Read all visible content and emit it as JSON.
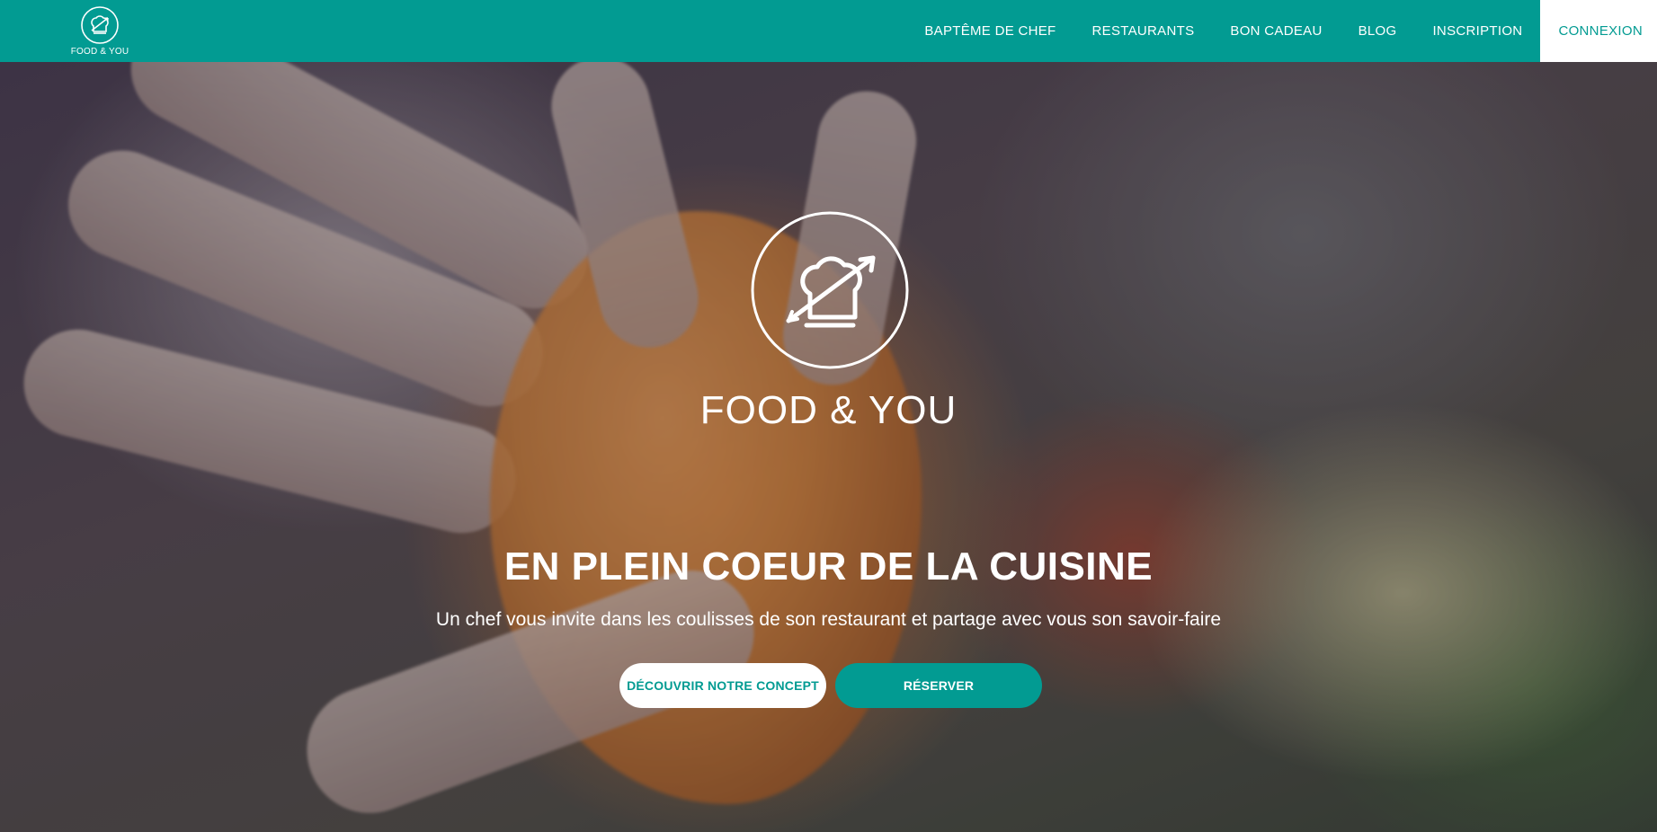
{
  "brand": {
    "logo_text": "FOOD & YOU",
    "hero_logo_text": "FOOD & YOU",
    "logo_icon": "chef-hat-arrow-icon"
  },
  "nav": {
    "items": [
      {
        "label": "BAPTÊME DE CHEF"
      },
      {
        "label": "RESTAURANTS"
      },
      {
        "label": "BON CADEAU"
      },
      {
        "label": "BLOG"
      },
      {
        "label": "INSCRIPTION"
      },
      {
        "label": "CONNEXION",
        "active": true
      }
    ]
  },
  "hero": {
    "title": "EN PLEIN COEUR DE LA CUISINE",
    "subtitle": "Un chef vous invite dans les coulisses de son restaurant et partage avec vous son savoir-faire",
    "buttons": {
      "discover": "DÉCOUVRIR NOTRE CONCEPT",
      "book": "RÉSERVER"
    }
  },
  "colors": {
    "brand_teal": "#029b92",
    "white": "#ffffff"
  }
}
